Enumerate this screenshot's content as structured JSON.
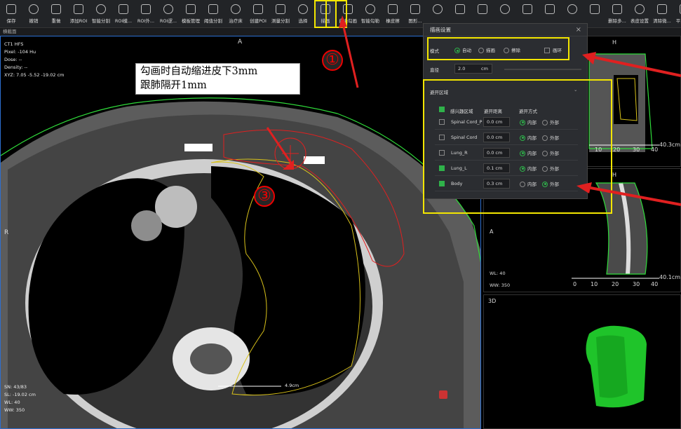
{
  "toolbar": {
    "items": [
      {
        "label": "保存",
        "icon": "save-icon"
      },
      {
        "label": "撤销",
        "icon": "undo-icon"
      },
      {
        "label": "重做",
        "icon": "redo-icon"
      },
      {
        "label": "添加ROI",
        "icon": "add-roi-icon"
      },
      {
        "label": "智能分割",
        "icon": "smart-segment-icon"
      },
      {
        "label": "ROI模...",
        "icon": "roi-template-icon"
      },
      {
        "label": "ROI外...",
        "icon": "roi-expand-icon"
      },
      {
        "label": "ROI逻...",
        "icon": "roi-logic-icon"
      },
      {
        "label": "模板管理",
        "icon": "template-icon"
      },
      {
        "label": "阈值分割",
        "icon": "threshold-icon"
      },
      {
        "label": "治疗床",
        "icon": "couch-icon"
      },
      {
        "label": "创建POI",
        "icon": "poi-icon"
      },
      {
        "label": "测量分割",
        "icon": "measure-icon"
      },
      {
        "label": "选择",
        "icon": "select-icon"
      },
      {
        "label": "描画",
        "icon": "draw-icon"
      },
      {
        "label": "自由勾画",
        "icon": "freehand-icon"
      },
      {
        "label": "智能勾勒",
        "icon": "smart-contour-icon"
      },
      {
        "label": "橡皮擦",
        "icon": "eraser-icon"
      },
      {
        "label": "图形...",
        "icon": "shape-icon"
      },
      {
        "label": "",
        "icon": "circle-icon"
      },
      {
        "label": "",
        "icon": "rectangle-icon"
      },
      {
        "label": "",
        "icon": "interp-icon"
      },
      {
        "label": "",
        "icon": "copy-icon"
      },
      {
        "label": "",
        "icon": "roi-icon"
      },
      {
        "label": "",
        "icon": "move-icon"
      },
      {
        "label": "",
        "icon": "move2-icon"
      },
      {
        "label": "",
        "icon": "brush-icon"
      },
      {
        "label": "删除多...",
        "icon": "delete-multi-icon"
      },
      {
        "label": "表皮设置",
        "icon": "skin-icon"
      },
      {
        "label": "清除微...",
        "icon": "clean-icon"
      },
      {
        "label": "平滑ROI",
        "icon": "smooth-icon"
      }
    ]
  },
  "subbar": "横截面",
  "main": {
    "info": [
      "CT1 HFS",
      "Pixel:  -104 Hu",
      "Dose:  --",
      "Density:  --",
      "XYZ: 7.05  -5.52  -19.02 cm"
    ],
    "bottom_info": [
      "SN: 43/83",
      "SL: -19.02 cm",
      "WL: 40",
      "WW: 350"
    ],
    "dir_top": "A",
    "dir_left": "R",
    "scale": "4.9cm",
    "note": [
      "勾画时自动缩进皮下3mm",
      "跟肺隔开1mm"
    ],
    "markers": [
      "①",
      "②",
      "③"
    ]
  },
  "dialog": {
    "title": "描画设置",
    "close": "×",
    "mode_label": "模式",
    "modes": [
      "自动",
      "描画",
      "擦除"
    ],
    "ring": "画环",
    "radius_label": "直径",
    "radius_value": "2.0",
    "radius_unit": "cm",
    "avoid_title": "避开区域",
    "cols": [
      "感兴趣区域",
      "避开距离",
      "避开方式"
    ],
    "rows": [
      {
        "name": "Spinal Cord_P",
        "dist": "0.0",
        "unit": "cm",
        "in": "内部",
        "out": "外部",
        "checked": false,
        "sel": "in"
      },
      {
        "name": "Spinal Cord",
        "dist": "0.0",
        "unit": "cm",
        "in": "内部",
        "out": "外部",
        "checked": false,
        "sel": "in"
      },
      {
        "name": "Lung_R",
        "dist": "0.0",
        "unit": "cm",
        "in": "内部",
        "out": "外部",
        "checked": false,
        "sel": "in"
      },
      {
        "name": "Lung_L",
        "dist": "0.1",
        "unit": "cm",
        "in": "内部",
        "out": "外部",
        "checked": true,
        "sel": "in"
      },
      {
        "name": "Body",
        "dist": "0.3",
        "unit": "cm",
        "in": "内部",
        "out": "外部",
        "checked": true,
        "sel": "out"
      }
    ]
  },
  "right": {
    "p1": {
      "top": "H",
      "scale": "40.3cm",
      "ticks": [
        "10",
        "20",
        "30",
        "40"
      ]
    },
    "p2": {
      "top": "H",
      "left": "A",
      "wl": "WL: 40",
      "ww": "WW: 350",
      "scale": "40.1cm",
      "ticks": [
        "0",
        "10",
        "20",
        "30",
        "40"
      ]
    },
    "p3": {
      "label": "3D"
    }
  }
}
